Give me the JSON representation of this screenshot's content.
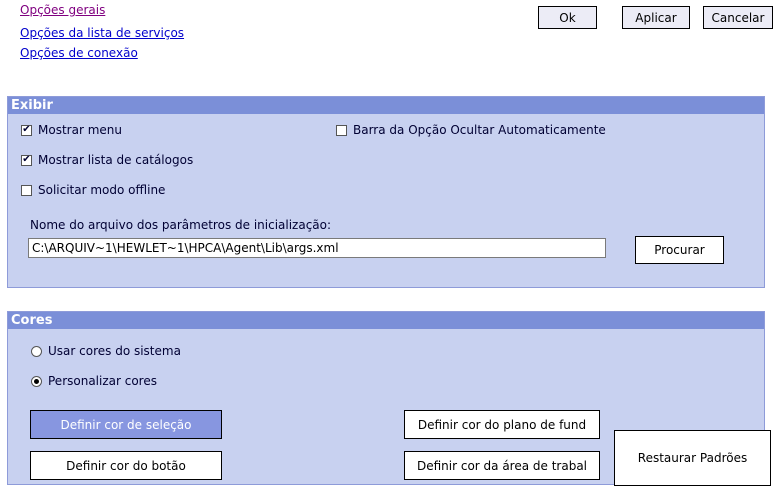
{
  "nav": {
    "links": [
      "Opções gerais",
      "Opções da lista de serviços",
      "Opções de conexão"
    ]
  },
  "toolbar": {
    "ok": "Ok",
    "apply": "Aplicar",
    "cancel": "Cancelar"
  },
  "exibir": {
    "title": "Exibir",
    "show_menu": {
      "label": "Mostrar menu",
      "checked": true
    },
    "autohide": {
      "label": "Barra da Opção Ocultar Automaticamente",
      "checked": false
    },
    "show_catalog": {
      "label": "Mostrar lista de catálogos",
      "checked": true
    },
    "offline": {
      "label": "Solicitar modo offline",
      "checked": false
    },
    "file_label": "Nome do arquivo dos parâmetros de inicialização:",
    "file_value": "C:\\ARQUIV~1\\HEWLET~1\\HPCA\\Agent\\Lib\\args.xml",
    "browse": "Procurar"
  },
  "cores": {
    "title": "Cores",
    "system_colors": {
      "label": "Usar cores do sistema",
      "selected": false
    },
    "custom_colors": {
      "label": "Personalizar cores",
      "selected": true
    },
    "selection_color": "Definir cor de seleção",
    "button_color": "Definir cor do botão",
    "background_color": "Definir cor do plano de fund",
    "workarea_color": "Definir cor da área de trabal",
    "restore": "Restaurar Padrões"
  },
  "colors": {
    "panel_bg": "#c8d1f0",
    "header_bg": "#7b8fd8",
    "selection_btn_bg": "#8796e0",
    "link": "#0000cc",
    "visited_link": "#800080"
  }
}
